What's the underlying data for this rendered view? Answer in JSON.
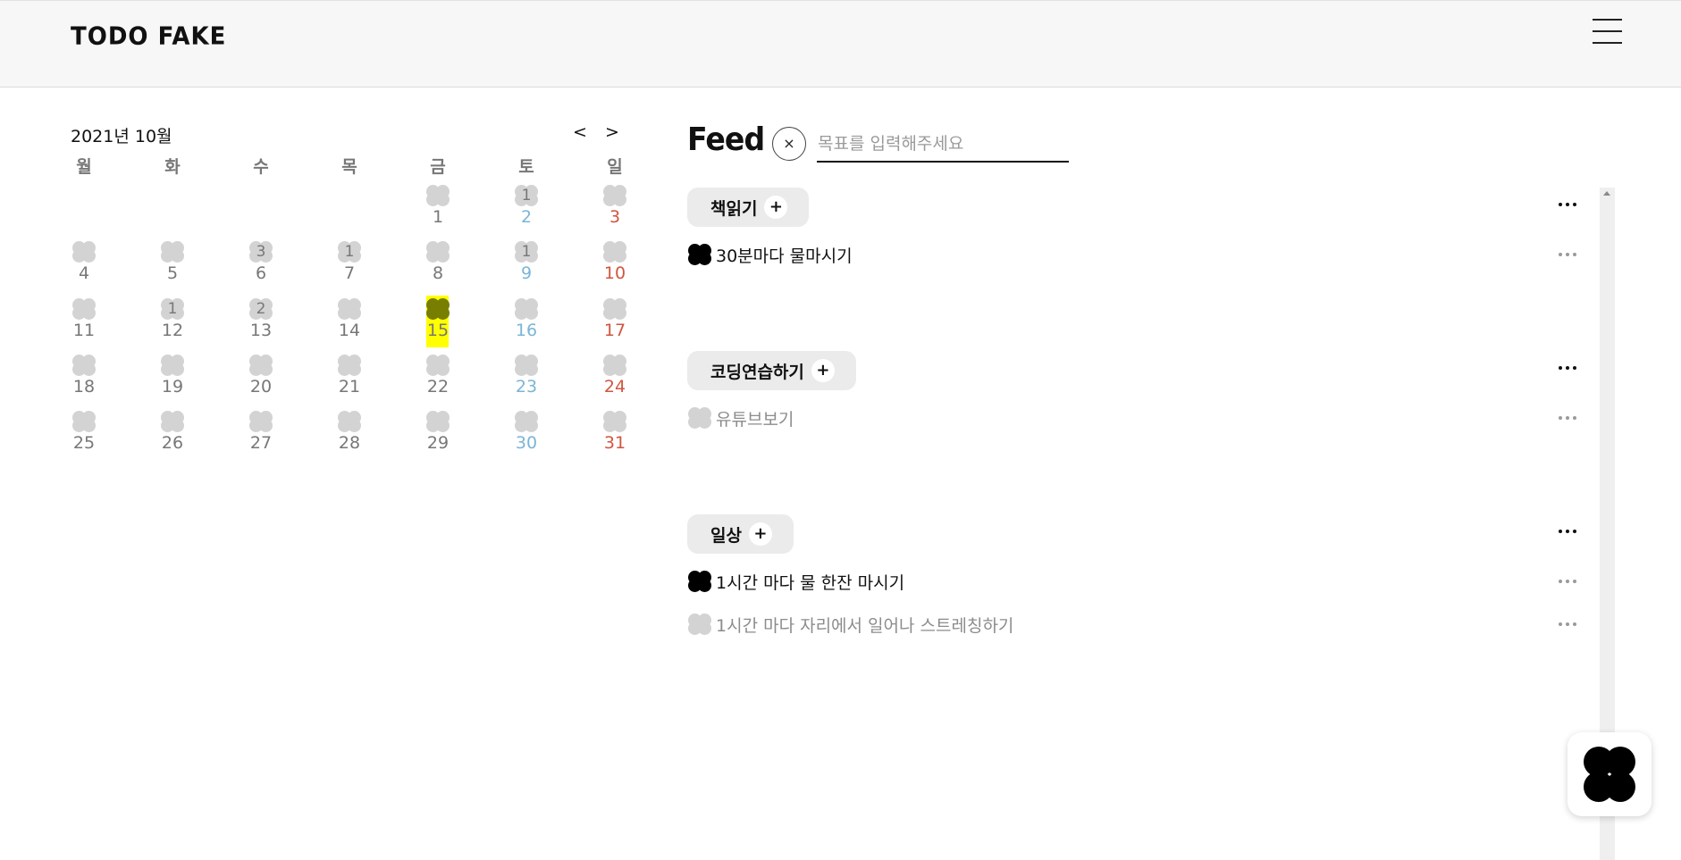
{
  "header": {
    "logo": "TODO FAKE"
  },
  "calendar": {
    "month_label": "2021년 10월",
    "prev_label": "<",
    "next_label": ">",
    "weekdays": [
      "월",
      "화",
      "수",
      "목",
      "금",
      "토",
      "일"
    ],
    "today": "15",
    "weeks": [
      [
        {
          "day": "",
          "count": ""
        },
        {
          "day": "",
          "count": ""
        },
        {
          "day": "",
          "count": ""
        },
        {
          "day": "",
          "count": ""
        },
        {
          "day": "1",
          "count": ""
        },
        {
          "day": "2",
          "count": "1"
        },
        {
          "day": "3",
          "count": ""
        }
      ],
      [
        {
          "day": "4",
          "count": ""
        },
        {
          "day": "5",
          "count": ""
        },
        {
          "day": "6",
          "count": "3"
        },
        {
          "day": "7",
          "count": "1"
        },
        {
          "day": "8",
          "count": ""
        },
        {
          "day": "9",
          "count": "1"
        },
        {
          "day": "10",
          "count": ""
        }
      ],
      [
        {
          "day": "11",
          "count": ""
        },
        {
          "day": "12",
          "count": "1"
        },
        {
          "day": "13",
          "count": "2"
        },
        {
          "day": "14",
          "count": ""
        },
        {
          "day": "15",
          "count": ""
        },
        {
          "day": "16",
          "count": ""
        },
        {
          "day": "17",
          "count": ""
        }
      ],
      [
        {
          "day": "18",
          "count": ""
        },
        {
          "day": "19",
          "count": ""
        },
        {
          "day": "20",
          "count": ""
        },
        {
          "day": "21",
          "count": ""
        },
        {
          "day": "22",
          "count": ""
        },
        {
          "day": "23",
          "count": ""
        },
        {
          "day": "24",
          "count": ""
        }
      ],
      [
        {
          "day": "25",
          "count": ""
        },
        {
          "day": "26",
          "count": ""
        },
        {
          "day": "27",
          "count": ""
        },
        {
          "day": "28",
          "count": ""
        },
        {
          "day": "29",
          "count": ""
        },
        {
          "day": "30",
          "count": ""
        },
        {
          "day": "31",
          "count": ""
        }
      ]
    ]
  },
  "feed": {
    "title": "Feed",
    "close_label": "×",
    "input_placeholder": "목표를 입력해주세요",
    "input_value": "",
    "add_label": "+",
    "categories": [
      {
        "name": "책읽기",
        "todos": [
          {
            "text": "30분마다 물마시기",
            "done": true
          }
        ]
      },
      {
        "name": "코딩연습하기",
        "todos": [
          {
            "text": "유튜브보기",
            "done": false
          }
        ]
      },
      {
        "name": "일상",
        "todos": [
          {
            "text": "1시간 마다 물 한잔 마시기",
            "done": true
          },
          {
            "text": "1시간 마다 자리에서 일어나 스트레칭하기",
            "done": false
          }
        ]
      }
    ]
  },
  "colors": {
    "today_highlight": "#ffff00",
    "saturday": "#7bb5d6",
    "sunday": "#d1553f",
    "clover_empty": "#d3d3d3",
    "clover_done": "#000000"
  },
  "icons": {
    "menu": "hamburger-menu-icon",
    "clover": "clover-icon",
    "more": "more-dots-icon",
    "close": "close-icon",
    "plus": "plus-icon"
  }
}
